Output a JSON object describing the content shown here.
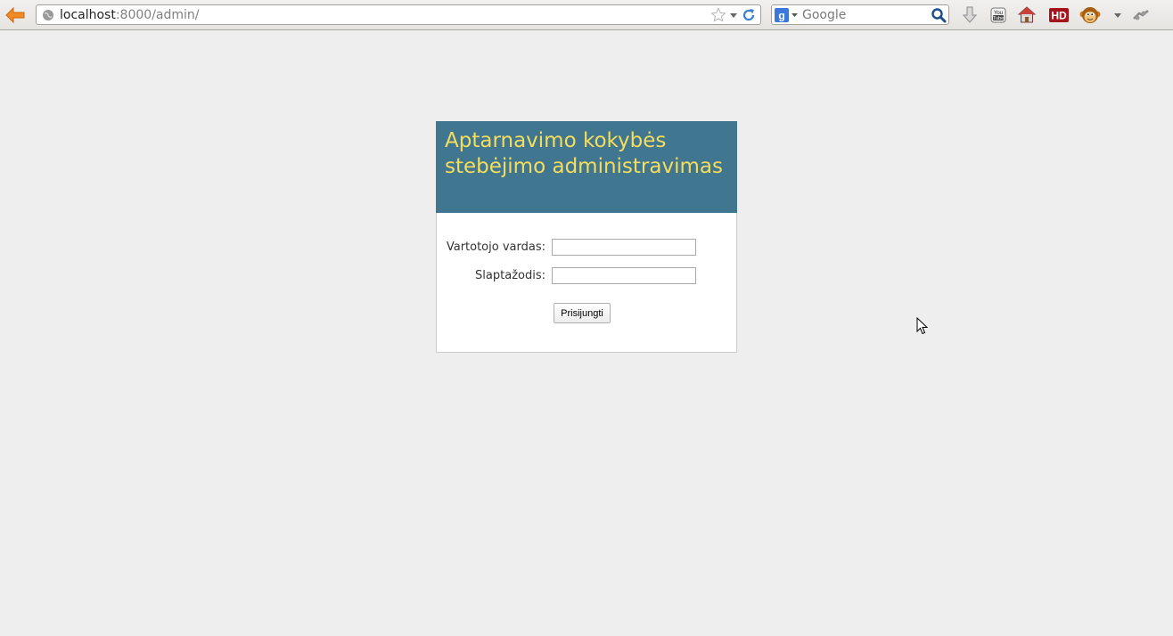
{
  "browser": {
    "url_host": "localhost",
    "url_path": ":8000/admin/",
    "search_placeholder": "Google",
    "search_engine_icon": "google-g-icon",
    "hd_label": "HD",
    "icons": [
      "back-arrow-icon",
      "globe-icon",
      "star-icon",
      "dropdown-icon",
      "reload-icon",
      "google-g-icon",
      "magnifier-icon",
      "download-icon",
      "youtube-icon",
      "home-icon",
      "hd-icon",
      "monkey-icon",
      "dropdown-icon",
      "addon-icon"
    ]
  },
  "login": {
    "title": "Aptarnavimo kokybės stebėjimo administravimas",
    "username_label": "Vartotojo vardas:",
    "username_value": "",
    "password_label": "Slaptažodis:",
    "password_value": "",
    "submit_label": "Prisijungti"
  },
  "colors": {
    "page_bg": "#eeeeee",
    "header_bg": "#417690",
    "title_text": "#f5dd5d"
  }
}
